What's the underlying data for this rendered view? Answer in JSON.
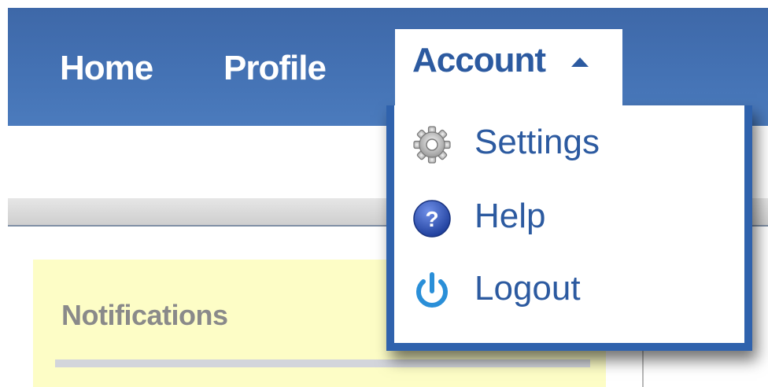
{
  "nav": {
    "home_label": "Home",
    "profile_label": "Profile",
    "account_label": "Account",
    "account_caret_icon": "caret-up-icon"
  },
  "account_menu": {
    "items": [
      {
        "label": "Settings",
        "icon": "gear-icon"
      },
      {
        "label": "Help",
        "icon": "help-icon"
      },
      {
        "label": "Logout",
        "icon": "power-icon"
      }
    ]
  },
  "notifications": {
    "title": "Notifications"
  },
  "colors": {
    "nav_bg": "#4472b4",
    "link_active": "#2c5aa0",
    "dropdown_border": "#2f62ad",
    "notifications_bg": "#fdfdc6"
  }
}
